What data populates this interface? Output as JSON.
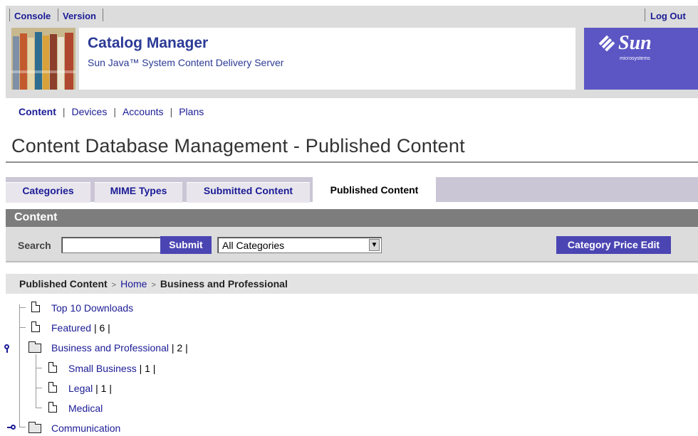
{
  "topbar": {
    "console": "Console",
    "version": "Version",
    "logout": "Log Out"
  },
  "banner": {
    "title": "Catalog Manager",
    "subtitle": "Sun Java™ System Content Delivery Server",
    "logo_text": "Sun",
    "logo_sub": "microsystems"
  },
  "mainnav": {
    "items": [
      "Content",
      "Devices",
      "Accounts",
      "Plans"
    ],
    "active": "Content",
    "separator": "|"
  },
  "page_title": "Content Database Management - Published Content",
  "tabs": [
    {
      "label": "Categories"
    },
    {
      "label": "MIME Types"
    },
    {
      "label": "Submitted Content"
    },
    {
      "label": "Published Content",
      "active": true
    }
  ],
  "content_section": {
    "title": "Content"
  },
  "search": {
    "label": "Search",
    "value": "",
    "submit_label": "Submit",
    "category_select": "All Categories",
    "price_edit_label": "Category Price Edit"
  },
  "breadcrumb": {
    "root": "Published Content",
    "sep": ">",
    "home": "Home",
    "current": "Business and Professional"
  },
  "tree": [
    {
      "label": "Top 10 Downloads",
      "count": "",
      "type": "doc"
    },
    {
      "label": "Featured",
      "count": "| 6 |",
      "type": "doc"
    },
    {
      "label": "Business and Professional",
      "count": "| 2 |",
      "type": "folder",
      "expanded": true
    },
    {
      "label": "Small Business",
      "count": "| 1 |",
      "type": "doc"
    },
    {
      "label": "Legal",
      "count": "| 1 |",
      "type": "doc"
    },
    {
      "label": "Medical",
      "count": "",
      "type": "doc"
    },
    {
      "label": "Communication",
      "count": "",
      "type": "folder",
      "expanded": false
    }
  ],
  "colors": {
    "link": "#1b1b96",
    "accent_button": "#4b45b3",
    "sun_purple": "#5b56c4",
    "section_bar": "#7d7d7d"
  }
}
